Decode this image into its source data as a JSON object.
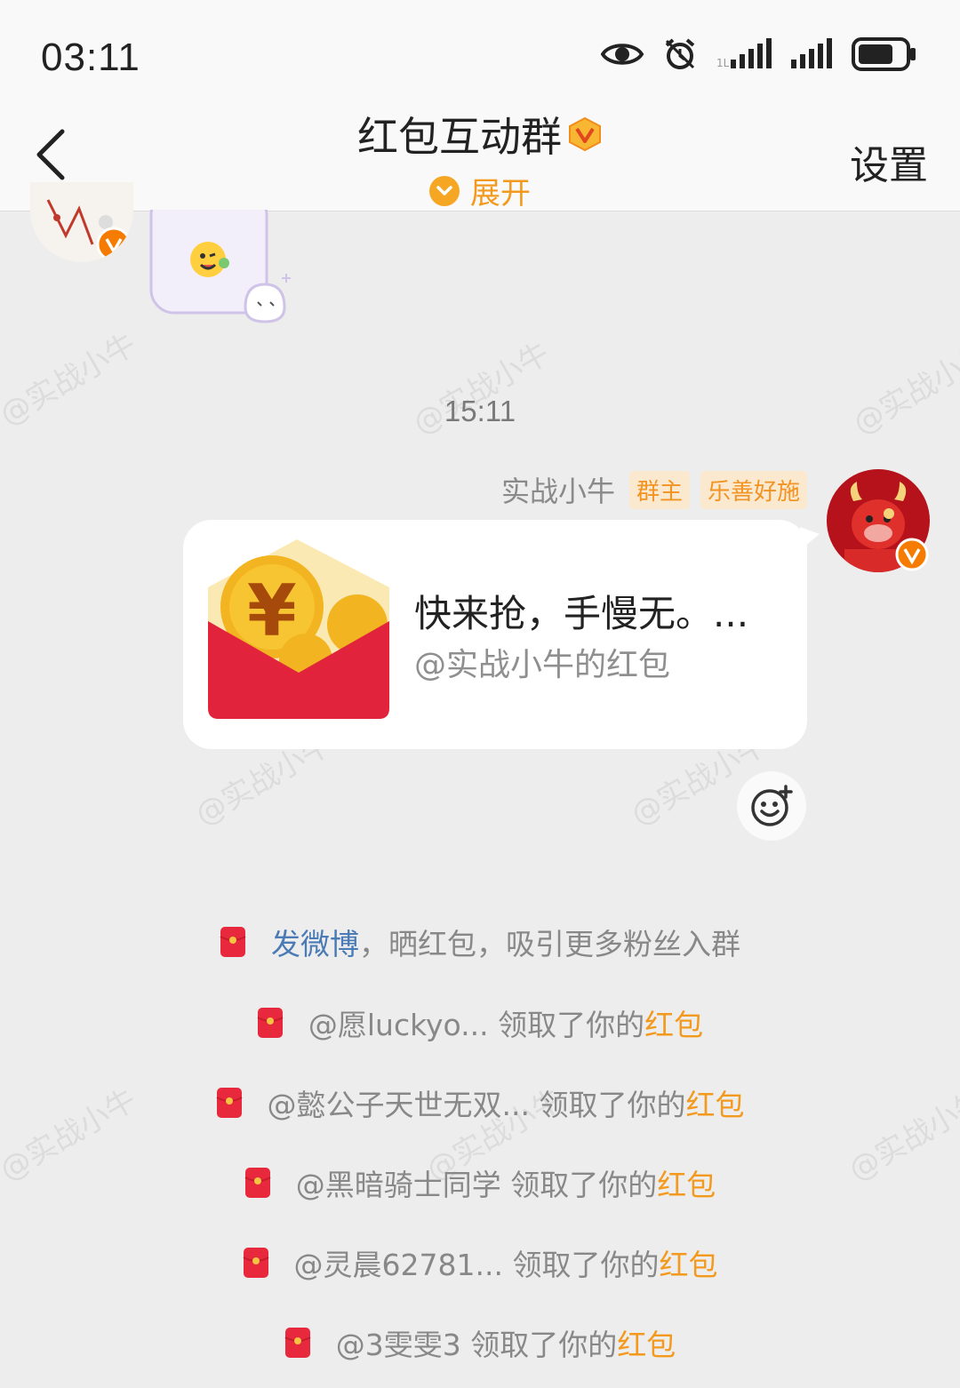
{
  "status_bar": {
    "time": "03:11",
    "icons": [
      "eye-icon",
      "alarm-icon",
      "signal-icon",
      "signal-icon",
      "battery-icon"
    ]
  },
  "header": {
    "back_icon": "chevron-left-icon",
    "title": "红包互动群",
    "badge_icon": "vip-badge-icon",
    "expand_label": "展开",
    "settings_label": "设置"
  },
  "watermark_text": "@实战小牛",
  "chat": {
    "timestamp": "15:11",
    "message": {
      "sender": "实战小牛",
      "tags": [
        "群主",
        "乐善好施"
      ],
      "red_packet": {
        "title": "快来抢，手慢无。...",
        "subtitle": "@实战小牛的红包",
        "icon": "red-envelope-icon"
      },
      "react_icon": "emoji-add-icon"
    },
    "notices": [
      {
        "link": "发微博",
        "text": "，晒红包，吸引更多粉丝入群",
        "highlight": ""
      },
      {
        "link": "",
        "text": "@愿luckyo... 领取了你的",
        "highlight": "红包"
      },
      {
        "link": "",
        "text": "@懿公子天世无双... 领取了你的",
        "highlight": "红包"
      },
      {
        "link": "",
        "text": "@黑暗骑士同学 领取了你的",
        "highlight": "红包"
      },
      {
        "link": "",
        "text": "@灵晨62781... 领取了你的",
        "highlight": "红包"
      },
      {
        "link": "",
        "text": "@3雯雯3 领取了你的",
        "highlight": "红包"
      }
    ]
  },
  "colors": {
    "accent_orange": "#f39a1e",
    "link_blue": "#4a7bb6",
    "red_packet": "#e8283c"
  }
}
